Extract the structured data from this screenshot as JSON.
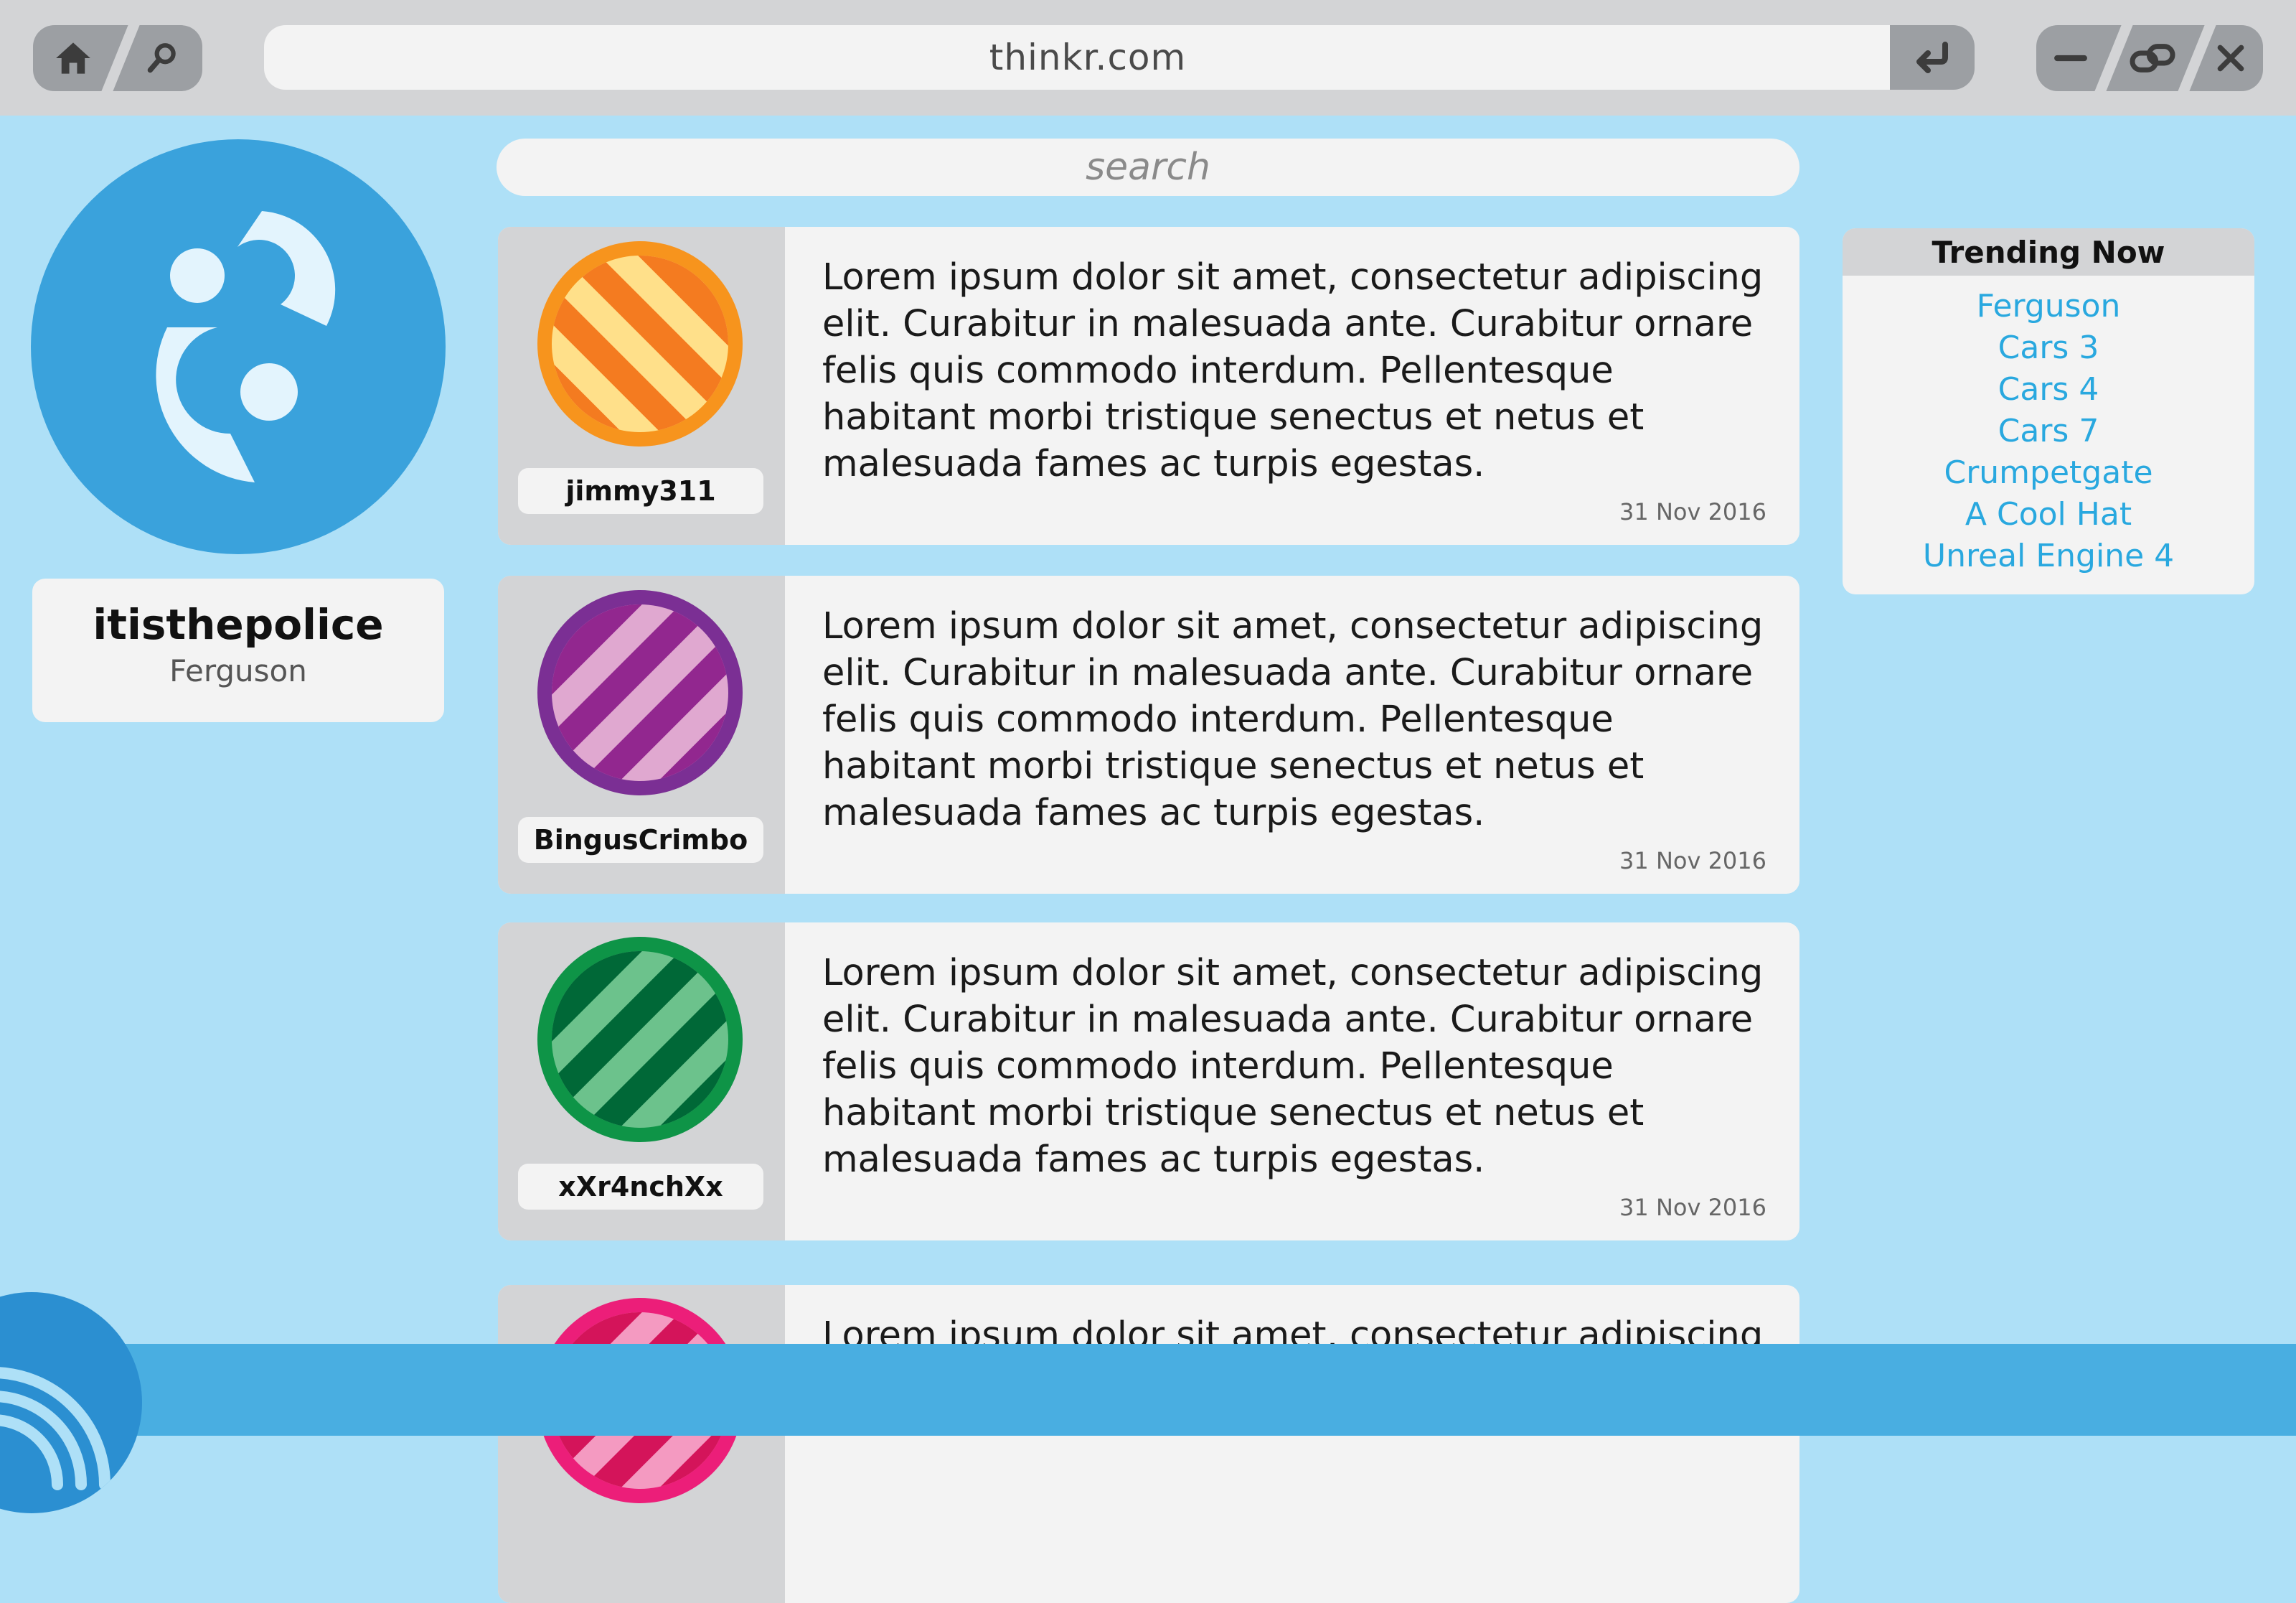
{
  "browser": {
    "url": "thinkr.com"
  },
  "profile": {
    "username": "itisthepolice",
    "location": "Ferguson"
  },
  "search": {
    "placeholder": "search"
  },
  "posts": [
    {
      "user": "jimmy311",
      "avatar_colors": {
        "ring": "#f7941d",
        "stripe_dark": "#f47b20",
        "stripe_light": "#ffe08a"
      },
      "text": "Lorem ipsum dolor sit amet, consectetur adipiscing elit. Curabitur in malesuada ante. Curabitur ornare felis quis commodo interdum. Pellentesque habitant morbi tristique senectus et netus et malesuada fames ac turpis egestas.",
      "date": "31 Nov 2016"
    },
    {
      "user": "BingusCrimbo",
      "avatar_colors": {
        "ring": "#7b2f94",
        "stripe_dark": "#92278f",
        "stripe_light": "#e0a8d0"
      },
      "text": "Lorem ipsum dolor sit amet, consectetur adipiscing elit. Curabitur in malesuada ante. Curabitur ornare felis quis commodo interdum. Pellentesque habitant morbi tristique senectus et netus et malesuada fames ac turpis egestas.",
      "date": "31 Nov 2016"
    },
    {
      "user": "xXr4nchXx",
      "avatar_colors": {
        "ring": "#0e9447",
        "stripe_dark": "#006837",
        "stripe_light": "#6cc28c"
      },
      "text": "Lorem ipsum dolor sit amet, consectetur adipiscing elit. Curabitur in malesuada ante. Curabitur ornare felis quis commodo interdum. Pellentesque habitant morbi tristique senectus et netus et malesuada fames ac turpis egestas.",
      "date": "31 Nov 2016"
    },
    {
      "user": "",
      "avatar_colors": {
        "ring": "#ec1e79",
        "stripe_dark": "#d4145a",
        "stripe_light": "#f49ac1"
      },
      "text": "Lorem ipsum dolor sit amet, consectetur adipiscing",
      "date": ""
    }
  ],
  "trending": {
    "title": "Trending Now",
    "items": [
      "Ferguson",
      "Cars 3",
      "Cars 4",
      "Cars 7",
      "Crumpetgate",
      "A Cool Hat",
      "Unreal Engine 4"
    ]
  },
  "colors": {
    "background": "#aee0f7",
    "accent": "#3aa2dc",
    "link": "#29a8df",
    "bottom_bar": "#49aee1"
  },
  "icons": [
    "home-icon",
    "search-icon",
    "enter-icon",
    "minimize-icon",
    "link-icon",
    "close-icon",
    "feed-icon"
  ]
}
